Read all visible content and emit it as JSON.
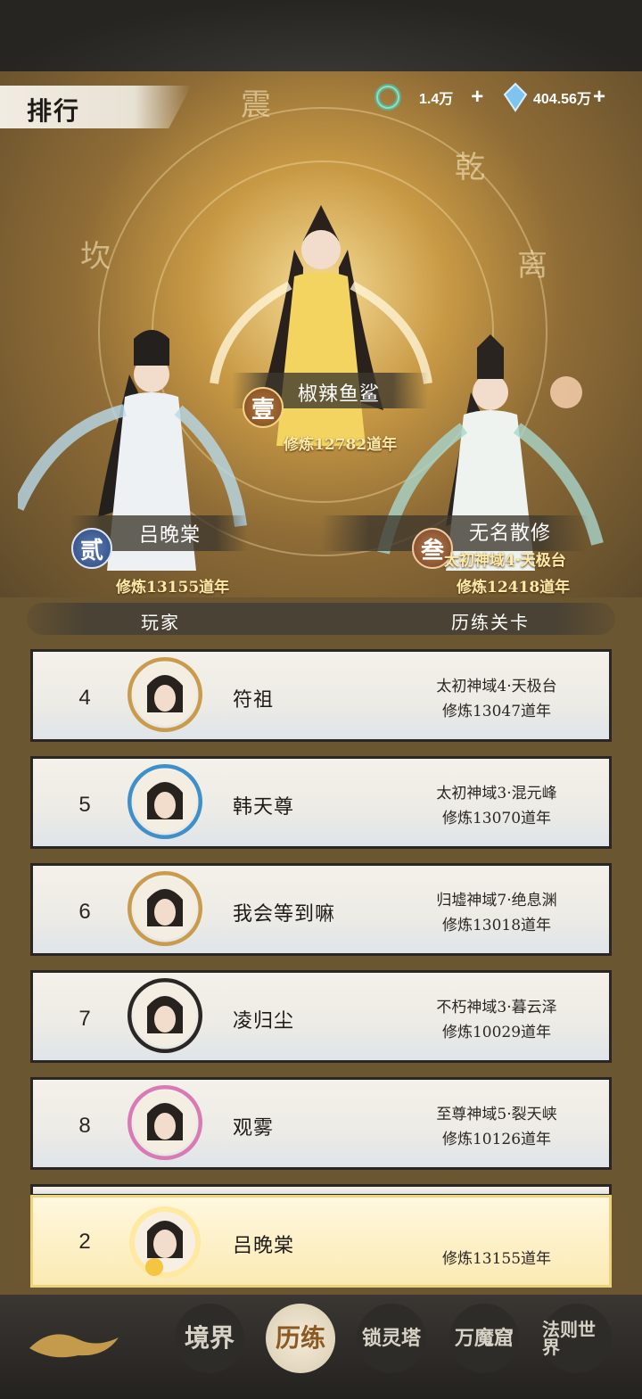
{
  "header": {
    "title": "排行"
  },
  "resources": [
    {
      "icon": "jade-ring-icon",
      "value": "1.4万",
      "add": "+"
    },
    {
      "icon": "spirit-crystal-icon",
      "value": "404.56万",
      "add": "+"
    }
  ],
  "hero_glyphs": [
    "震",
    "乾",
    "坎",
    "离"
  ],
  "podium": [
    {
      "rank_glyph": "壹",
      "name": "椒辣鱼鲨",
      "stage": "",
      "cultivation": "修炼12782道年"
    },
    {
      "rank_glyph": "贰",
      "name": "吕晚棠",
      "stage": "",
      "cultivation": "修炼13155道年"
    },
    {
      "rank_glyph": "叁",
      "name": "无名散修",
      "stage": "太初神域4·天极台",
      "cultivation": "修炼12418道年"
    }
  ],
  "columns": {
    "player": "玩家",
    "stage": "历练关卡"
  },
  "ranking": [
    {
      "rank": "4",
      "name": "符祖",
      "stage": "太初神域4·天极台",
      "cultivation": "修炼13047道年",
      "frame": "#c99b4a"
    },
    {
      "rank": "5",
      "name": "韩天尊",
      "stage": "太初神域3·混元峰",
      "cultivation": "修炼13070道年",
      "frame": "#3f8fc9"
    },
    {
      "rank": "6",
      "name": "我会等到嘛",
      "stage": "归墟神域7·绝息渊",
      "cultivation": "修炼13018道年",
      "frame": "#c99b4a"
    },
    {
      "rank": "7",
      "name": "凌归尘",
      "stage": "不朽神域3·暮云泽",
      "cultivation": "修炼10029道年",
      "frame": "#2b2623"
    },
    {
      "rank": "8",
      "name": "观雾",
      "stage": "至尊神域5·裂天峡",
      "cultivation": "修炼10126道年",
      "frame": "#d97ab2"
    }
  ],
  "my_rank": {
    "rank": "2",
    "name": "吕晚棠",
    "stage": "",
    "cultivation": "修炼13155道年"
  },
  "nav": [
    {
      "label": "境界"
    },
    {
      "label": "历练"
    },
    {
      "label": "锁灵塔"
    },
    {
      "label": "万魔窟"
    },
    {
      "label": "法则世界"
    }
  ]
}
